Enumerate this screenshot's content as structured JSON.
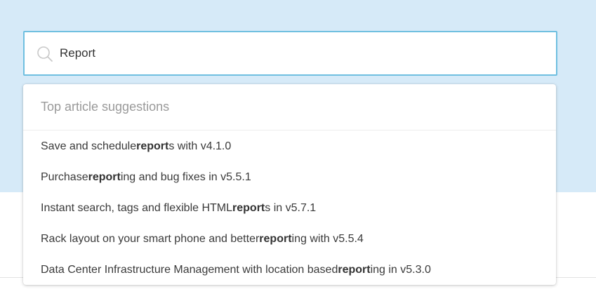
{
  "search": {
    "value": "Report",
    "icon": "search-icon"
  },
  "dropdown": {
    "heading": "Top article suggestions",
    "suggestions": [
      {
        "before": "Save and schedule ",
        "match": "report",
        "after": "s with v4.1.0"
      },
      {
        "before": "Purchase ",
        "match": "report",
        "after": "ing and bug fixes in v5.5.1"
      },
      {
        "before": "Instant search, tags and flexible HTML ",
        "match": "report",
        "after": "s in v5.7.1"
      },
      {
        "before": "Rack layout on your smart phone and better ",
        "match": "report",
        "after": "ing with v5.5.4"
      },
      {
        "before": "Data Center Infrastructure Management with location based ",
        "match": "report",
        "after": "ing in v5.3.0"
      }
    ]
  },
  "colors": {
    "hero_background": "#d6eaf8",
    "input_border": "#6fbfe0",
    "muted_text": "#9a9a9a",
    "body_text": "#3a3a3a"
  }
}
